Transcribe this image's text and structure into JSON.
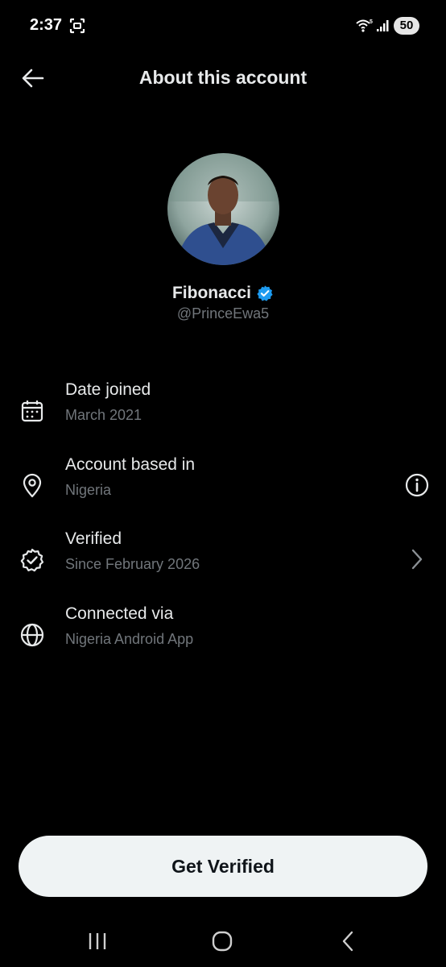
{
  "status_bar": {
    "time": "2:37",
    "battery": "50",
    "icons": [
      "screenshot-icon",
      "wifi-icon",
      "signal-icon",
      "battery-icon"
    ]
  },
  "header": {
    "title": "About this account",
    "back_icon": "arrow-left-icon"
  },
  "profile": {
    "name": "Fibonacci",
    "handle": "@PrinceEwa5",
    "verified_badge_color": "#1d9bf0"
  },
  "details": [
    {
      "label": "Date joined",
      "value": "March 2021",
      "icon": "calendar-icon"
    },
    {
      "label": "Account based in",
      "value": "Nigeria",
      "icon": "location-pin-icon",
      "action_icon": "info-icon"
    },
    {
      "label": "Verified",
      "value": "Since February 2026",
      "icon": "verified-check-icon",
      "action_icon": "chevron-right-icon"
    },
    {
      "label": "Connected via",
      "value": "Nigeria Android App",
      "icon": "globe-icon"
    }
  ],
  "cta": {
    "label": "Get Verified"
  },
  "nav": [
    "recent-apps-icon",
    "home-icon",
    "back-icon"
  ],
  "colors": {
    "background": "#000000",
    "text_primary": "#e7e9ea",
    "text_secondary": "#71767b",
    "button_bg": "#eff3f4"
  }
}
